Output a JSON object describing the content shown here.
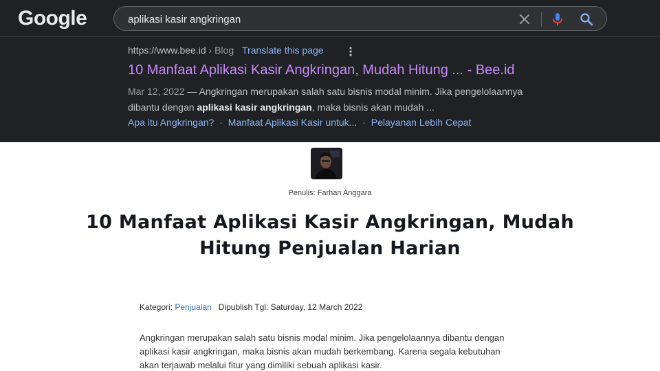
{
  "google": {
    "logo": "Google",
    "search_query": "aplikasi kasir angkringan"
  },
  "result": {
    "url": "https://www.bee.id",
    "separator": "›",
    "path": "Blog",
    "translate_label": "Translate this page",
    "title": "10 Manfaat Aplikasi Kasir Angkringan, Mudah Hitung ... - Bee.id",
    "date": "Mar 12, 2022",
    "dash": " — ",
    "snippet_part1": "Angkringan merupakan salah satu bisnis modal minim. Jika pengelolaannya dibantu dengan ",
    "snippet_bold": "aplikasi kasir angkringan",
    "snippet_part2": ", maka bisnis akan mudah ...",
    "sitelinks": [
      "Apa itu Angkringan?",
      "Manfaat Aplikasi Kasir untuk...",
      "Pelayanan Lebih Cepat"
    ],
    "sitelink_separator": "·"
  },
  "article": {
    "author_label": "Penulis: Farhan Anggara",
    "headline": "10 Manfaat Aplikasi Kasir Angkringan, Mudah Hitung Penjualan Harian",
    "category_label": "Kategori: ",
    "category_value": "Penjualan",
    "published_label": "Dipublish Tgl: Saturday, 12 March 2022",
    "body": "Angkringan merupakan salah satu bisnis modal minim. Jika pengelolaannya dibantu dengan aplikasi kasir angkringan, maka bisnis akan mudah berkembang. Karena segala kebutuhan akan terjawab melalui fitur yang dimiliki sebuah aplikasi kasir."
  },
  "icons": {
    "clear": "close-icon",
    "voice": "microphone-icon",
    "search": "search-icon",
    "more": "more-vert-icon"
  },
  "colors": {
    "dark_bg": "#202124",
    "visited_link": "#c58af9",
    "link": "#8ab4f8",
    "article_link": "#2f6fb7"
  }
}
